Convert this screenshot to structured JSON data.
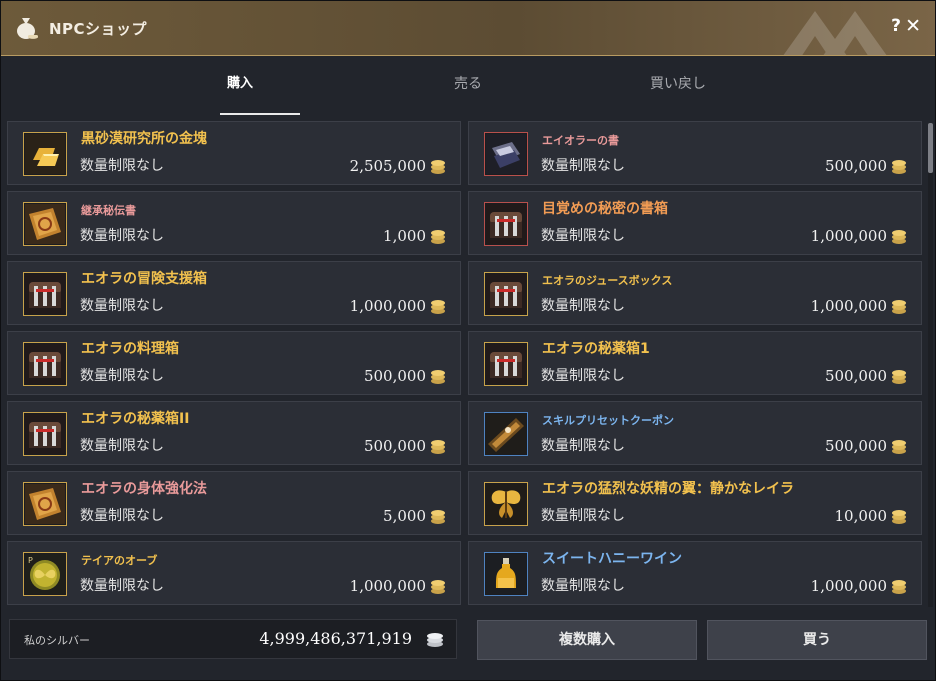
{
  "window": {
    "title": "NPCショップ",
    "help": "?",
    "close": "✕"
  },
  "tabs": [
    {
      "label": "購入",
      "active": true
    },
    {
      "label": "売る",
      "active": false
    },
    {
      "label": "買い戻し",
      "active": false
    }
  ],
  "items": [
    {
      "name": "黒砂漠研究所の金塊",
      "limit": "数量制限なし",
      "price": "2,505,000",
      "icon": "gold-bar-icon"
    },
    {
      "name": "エイオラーの書",
      "limit": "数量制限なし",
      "price": "500,000",
      "icon": "book-icon"
    },
    {
      "name": "継承秘伝書",
      "limit": "数量制限なし",
      "price": "1,000",
      "icon": "skill-book-icon"
    },
    {
      "name": "目覚めの秘密の書箱",
      "limit": "数量制限なし",
      "price": "1,000,000",
      "icon": "chest-icon"
    },
    {
      "name": "エオラの冒険支援箱",
      "limit": "数量制限なし",
      "price": "1,000,000",
      "icon": "chest-icon"
    },
    {
      "name": "エオラのジュースボックス",
      "limit": "数量制限なし",
      "price": "1,000,000",
      "icon": "chest-icon"
    },
    {
      "name": "エオラの料理箱",
      "limit": "数量制限なし",
      "price": "500,000",
      "icon": "chest-icon"
    },
    {
      "name": "エオラの秘薬箱1",
      "limit": "数量制限なし",
      "price": "500,000",
      "icon": "chest-icon"
    },
    {
      "name": "エオラの秘薬箱II",
      "limit": "数量制限なし",
      "price": "500,000",
      "icon": "chest-icon"
    },
    {
      "name": "スキルプリセットクーポン",
      "limit": "数量制限なし",
      "price": "500,000",
      "icon": "coupon-icon"
    },
    {
      "name": "エオラの身体強化法",
      "limit": "数量制限なし",
      "price": "5,000",
      "icon": "skill-book-icon"
    },
    {
      "name": "エオラの猛烈な妖精の翼：静かなレイラ",
      "limit": "数量制限なし",
      "price": "10,000",
      "icon": "fairy-wings-icon"
    },
    {
      "name": "テイアのオーブ",
      "limit": "数量制限なし",
      "price": "1,000,000",
      "icon": "orb-icon"
    },
    {
      "name": "スイートハニーワイン",
      "limit": "数量制限なし",
      "price": "1,000,000",
      "icon": "wine-bottle-icon"
    }
  ],
  "footer": {
    "silver_label": "私のシルバー",
    "silver_value": "4,999,486,371,919",
    "multi_buy": "複数購入",
    "buy": "買う"
  }
}
